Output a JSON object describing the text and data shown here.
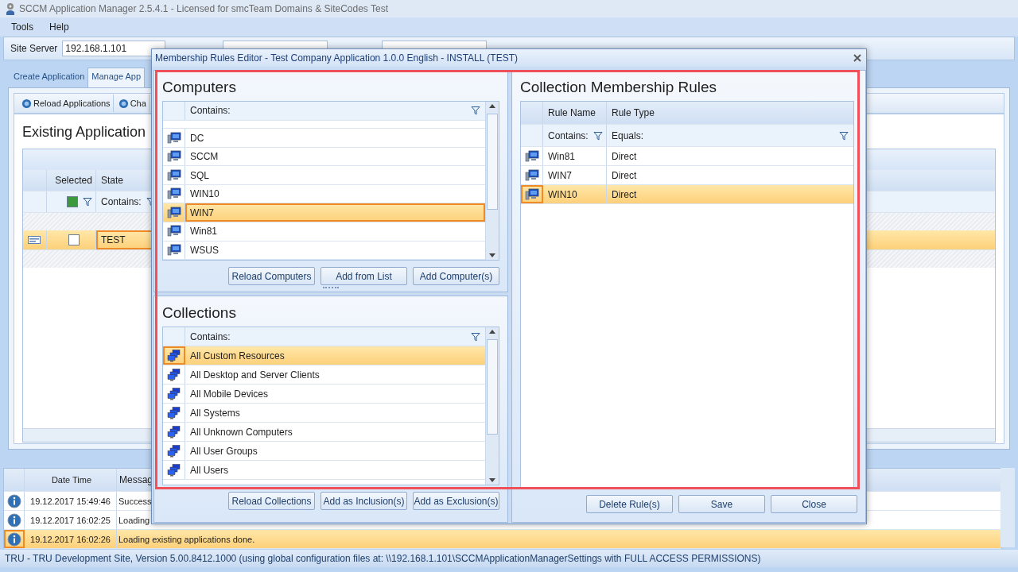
{
  "window": {
    "title": "SCCM Application Manager 2.5.4.1 - Licensed for smcTeam Domains & SiteCodes Test"
  },
  "menu": [
    {
      "label": "Tools"
    },
    {
      "label": "Help"
    }
  ],
  "toolbar": {
    "site_server_label": "Site Server",
    "site_server_value": "192.168.1.101"
  },
  "tabs": [
    {
      "label": "Create Application",
      "selected": false
    },
    {
      "label": "Manage App",
      "selected": true
    }
  ],
  "panel_toolbar": [
    "Reload Applications",
    "Cha"
  ],
  "heading": "Existing Application",
  "applications": {
    "columns": [
      "Selected",
      "State"
    ],
    "selected_filter_checked": true,
    "state_filter": "Contains:",
    "rows": [
      {
        "checked": false,
        "state": "TEST",
        "selected": true
      }
    ]
  },
  "log": {
    "columns": [
      "Date Time",
      "Messag"
    ],
    "rows": [
      {
        "time": "19.12.2017 15:49:46",
        "message": "Success",
        "selected": false
      },
      {
        "time": "19.12.2017 16:02:25",
        "message": "Loading",
        "selected": false
      },
      {
        "time": "19.12.2017 16:02:26",
        "message": "Loading existing applications done.",
        "selected": true
      }
    ]
  },
  "status_bar": "TRU - TRU Development Site, Version 5.00.8412.1000 (using global configuration files at: \\\\192.168.1.101\\SCCMApplicationManagerSettings with FULL ACCESS PERMISSIONS)",
  "dialog": {
    "title": "Membership Rules Editor - Test Company Application 1.0.0 English - INSTALL (TEST)",
    "computers": {
      "title": "Computers",
      "filter": "Contains:",
      "items": [
        {
          "name": "DC",
          "selected": false
        },
        {
          "name": "SCCM",
          "selected": false
        },
        {
          "name": "SQL",
          "selected": false
        },
        {
          "name": "WIN10",
          "selected": false
        },
        {
          "name": "WIN7",
          "selected": true
        },
        {
          "name": "Win81",
          "selected": false
        },
        {
          "name": "WSUS",
          "selected": false
        }
      ],
      "buttons": [
        "Reload Computers",
        "Add from List",
        "Add Computer(s)"
      ]
    },
    "collections": {
      "title": "Collections",
      "filter": "Contains:",
      "items": [
        {
          "name": "All Custom Resources",
          "selected": true
        },
        {
          "name": "All Desktop and Server Clients",
          "selected": false
        },
        {
          "name": "All Mobile Devices",
          "selected": false
        },
        {
          "name": "All Systems",
          "selected": false
        },
        {
          "name": "All Unknown Computers",
          "selected": false
        },
        {
          "name": "All User Groups",
          "selected": false
        },
        {
          "name": "All Users",
          "selected": false
        }
      ],
      "buttons": [
        "Reload Collections",
        "Add as Inclusion(s)",
        "Add as Exclusion(s)"
      ]
    },
    "rules": {
      "title": "Collection Membership Rules",
      "columns": [
        "Rule Name",
        "Rule Type"
      ],
      "filters": [
        "Contains:",
        "Equals:"
      ],
      "rows": [
        {
          "name": "Win81",
          "type": "Direct",
          "selected": false
        },
        {
          "name": "WIN7",
          "type": "Direct",
          "selected": false
        },
        {
          "name": "WIN10",
          "type": "Direct",
          "selected": true
        }
      ]
    },
    "buttons": [
      "Delete Rule(s)",
      "Save",
      "Close"
    ]
  }
}
